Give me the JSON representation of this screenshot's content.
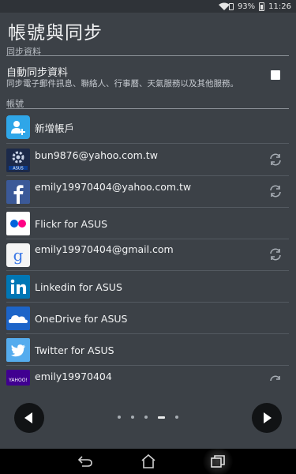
{
  "status": {
    "battery": "93%",
    "time": "11:26"
  },
  "page": {
    "title": "帳號與同步"
  },
  "sections": {
    "sync": "同步資料",
    "accounts": "帳號"
  },
  "sync_setting": {
    "title": "自動同步資料",
    "description": "同步電子郵件訊息、聯絡人、行事曆、天氣服務以及其他服務。",
    "checked": false
  },
  "accounts": [
    {
      "label": "新增帳戶",
      "icon": "add-account-icon",
      "sync": false
    },
    {
      "label": "bun9876@yahoo.com.tw",
      "icon": "asus-settings-icon",
      "sync": true
    },
    {
      "label": "emily19970404@yahoo.com.tw",
      "icon": "facebook-icon",
      "sync": true
    },
    {
      "label": "Flickr for ASUS",
      "icon": "flickr-icon",
      "sync": false
    },
    {
      "label": "emily19970404@gmail.com",
      "icon": "google-icon",
      "sync": true
    },
    {
      "label": "Linkedin for ASUS",
      "icon": "linkedin-icon",
      "sync": false
    },
    {
      "label": "OneDrive for ASUS",
      "icon": "onedrive-icon",
      "sync": false
    },
    {
      "label": "Twitter for ASUS",
      "icon": "twitter-icon",
      "sync": false
    },
    {
      "label": "emily19970404",
      "icon": "yahoo-icon",
      "sync": true
    }
  ],
  "yahoo_logo_text": "YAHOO!",
  "pager": {
    "pages": 5,
    "current": 4
  },
  "colors": {
    "background": "#3c4147",
    "facebook": "#3b5998",
    "linkedin": "#0077b5",
    "twitter": "#55acee",
    "onedrive": "#1c64c8",
    "yahoo": "#400090"
  }
}
